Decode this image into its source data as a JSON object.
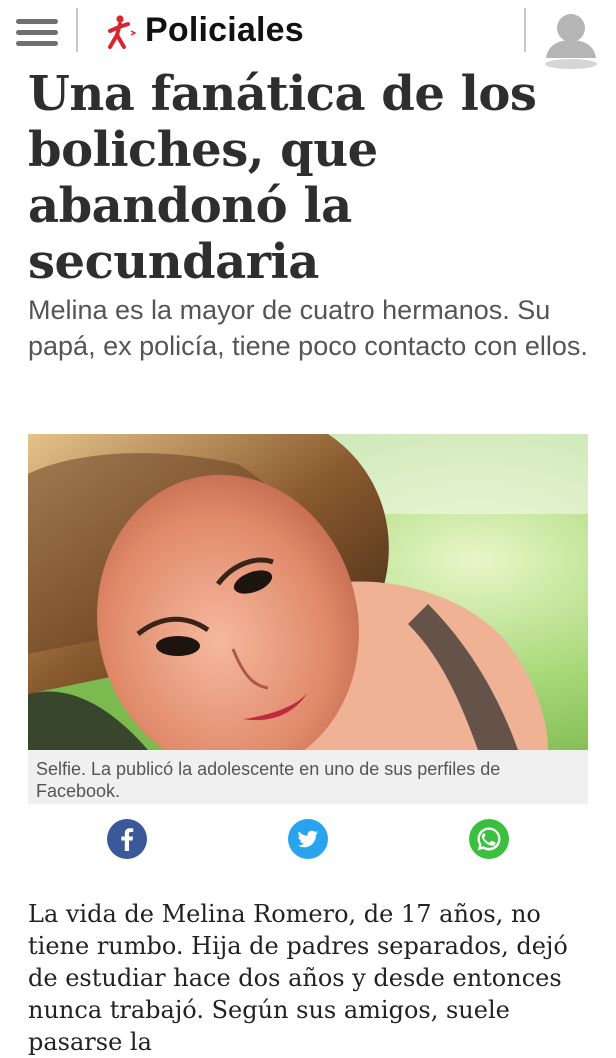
{
  "header": {
    "section_title": "Policiales",
    "colors": {
      "brand_red": "#d7262e",
      "icon_gray": "#707070"
    }
  },
  "article": {
    "headline": "Una fanática de los boliches, que abandonó la secundaria",
    "subheadline": "Melina es la mayor de cuatro hermanos. Su papá, ex policía, tiene poco contacto con ellos.",
    "photo_caption": "Selfie. La publicó la adolescente en uno de sus perfiles de Facebook.",
    "body_first_paragraph": "La vida de Melina Romero, de 17 años, no tiene rumbo. Hija de padres separados, dejó de estudiar hace dos años y desde entonces nunca trabajó. Según sus amigos, suele pasarse la"
  },
  "share": {
    "facebook_color": "#3b5998",
    "twitter_color": "#2aa3ef",
    "whatsapp_color": "#3bbf3f"
  },
  "icons": {
    "menu": "hamburger-menu-icon",
    "brand": "running-figure-logo-icon",
    "avatar": "user-avatar-icon",
    "facebook": "facebook-icon",
    "twitter": "twitter-icon",
    "whatsapp": "whatsapp-icon"
  }
}
